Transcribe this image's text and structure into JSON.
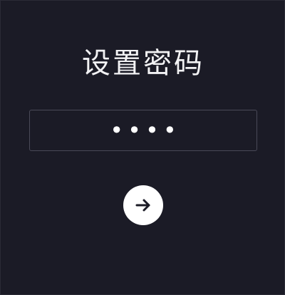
{
  "screen": {
    "title": "设置密码",
    "password": {
      "masked_value": "••••",
      "digit_count": 4
    },
    "submit": {
      "icon": "arrow-right-icon"
    }
  },
  "colors": {
    "background": "#1b1b26",
    "text": "#f2f2f4",
    "field_border": "#4a4a58",
    "button_fill": "#ffffff",
    "button_icon": "#1b1b26"
  }
}
